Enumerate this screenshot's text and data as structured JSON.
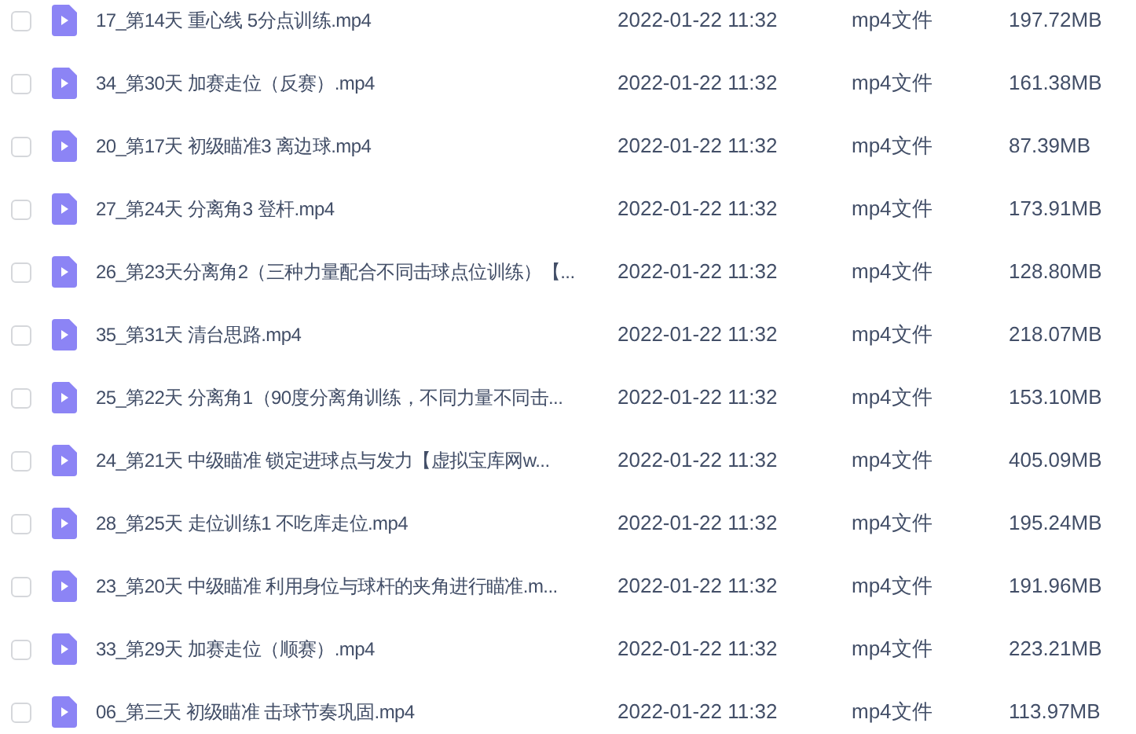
{
  "files": [
    {
      "checked": false,
      "name": "17_第14天 重心线  5分点训练.mp4",
      "modified": "2022-01-22 11:32",
      "type": "mp4文件",
      "size": "197.72MB"
    },
    {
      "checked": false,
      "name": "34_第30天 加赛走位（反赛）.mp4",
      "modified": "2022-01-22 11:32",
      "type": "mp4文件",
      "size": "161.38MB"
    },
    {
      "checked": false,
      "name": "20_第17天 初级瞄准3 离边球.mp4",
      "modified": "2022-01-22 11:32",
      "type": "mp4文件",
      "size": "87.39MB"
    },
    {
      "checked": false,
      "name": "27_第24天 分离角3 登杆.mp4",
      "modified": "2022-01-22 11:32",
      "type": "mp4文件",
      "size": "173.91MB"
    },
    {
      "checked": false,
      "name": "26_第23天分离角2（三种力量配合不同击球点位训练）【...",
      "modified": "2022-01-22 11:32",
      "type": "mp4文件",
      "size": "128.80MB"
    },
    {
      "checked": false,
      "name": "35_第31天 清台思路.mp4",
      "modified": "2022-01-22 11:32",
      "type": "mp4文件",
      "size": "218.07MB"
    },
    {
      "checked": false,
      "name": "25_第22天 分离角1（90度分离角训练，不同力量不同击...",
      "modified": "2022-01-22 11:32",
      "type": "mp4文件",
      "size": "153.10MB"
    },
    {
      "checked": false,
      "name": "24_第21天 中级瞄准  锁定进球点与发力【虚拟宝库网w...",
      "modified": "2022-01-22 11:32",
      "type": "mp4文件",
      "size": "405.09MB"
    },
    {
      "checked": false,
      "name": "28_第25天  走位训练1 不吃库走位.mp4",
      "modified": "2022-01-22 11:32",
      "type": "mp4文件",
      "size": "195.24MB"
    },
    {
      "checked": false,
      "name": "23_第20天 中级瞄准  利用身位与球杆的夹角进行瞄准.m...",
      "modified": "2022-01-22 11:32",
      "type": "mp4文件",
      "size": "191.96MB"
    },
    {
      "checked": false,
      "name": "33_第29天 加赛走位（顺赛）.mp4",
      "modified": "2022-01-22 11:32",
      "type": "mp4文件",
      "size": "223.21MB"
    },
    {
      "checked": false,
      "name": "06_第三天 初级瞄准 击球节奏巩固.mp4",
      "modified": "2022-01-22 11:32",
      "type": "mp4文件",
      "size": "113.97MB"
    }
  ]
}
